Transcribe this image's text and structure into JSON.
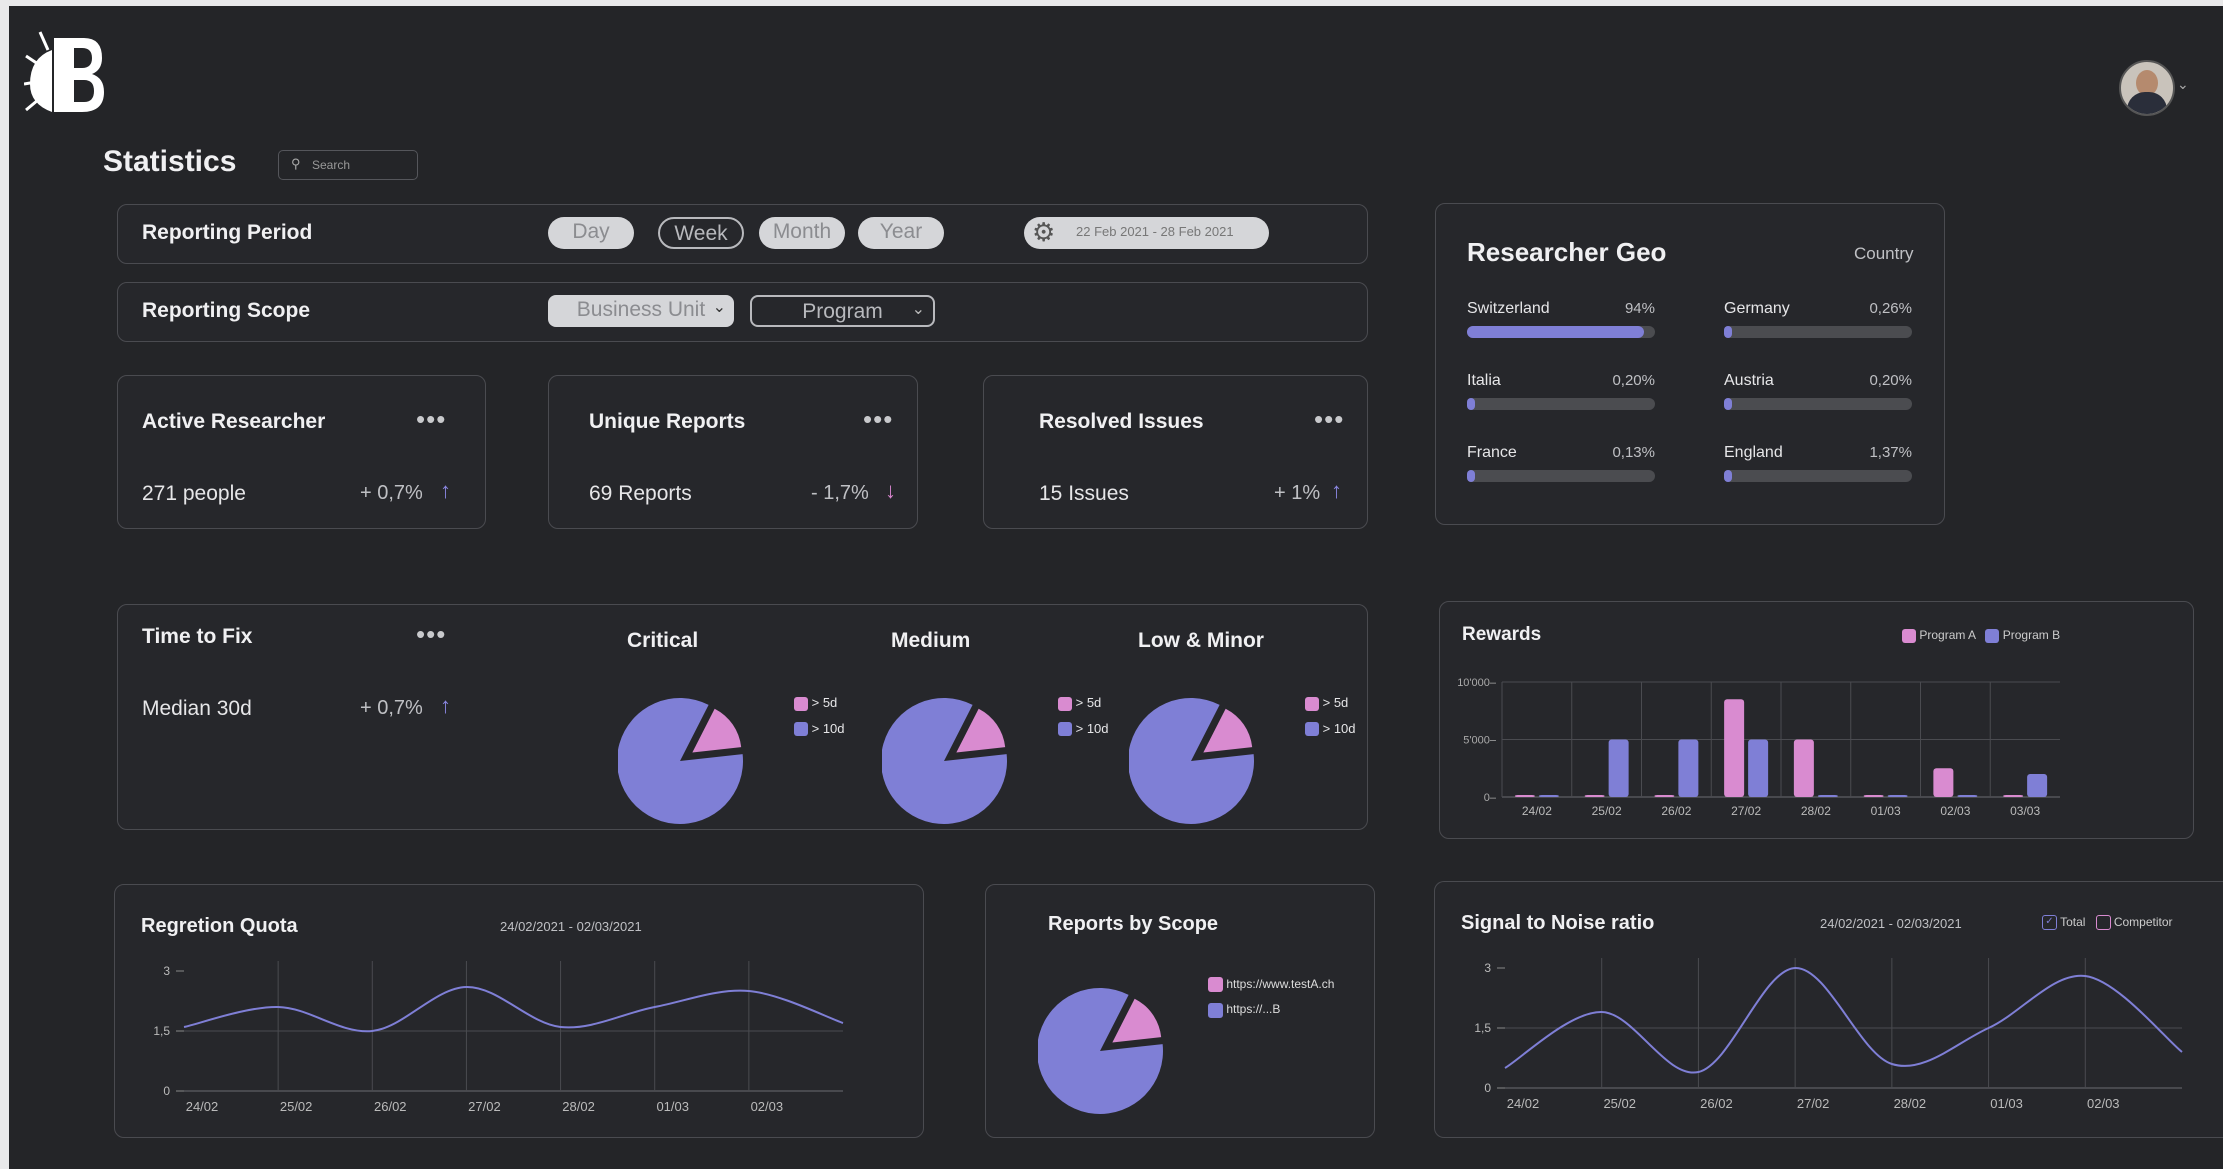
{
  "header": {
    "title": "Statistics",
    "search_placeholder": "Search"
  },
  "reporting_period": {
    "label": "Reporting Period",
    "options": [
      "Day",
      "Week",
      "Month",
      "Year"
    ],
    "date_range": "22 Feb 2021 - 28 Feb 2021"
  },
  "reporting_scope": {
    "label": "Reporting Scope",
    "business_unit": "Business Unit",
    "program": "Program"
  },
  "kpis": [
    {
      "title": "Active Researcher",
      "value": "271 people",
      "change": "+ 0,7%",
      "direction": "up"
    },
    {
      "title": "Unique Reports",
      "value": "69 Reports",
      "change": "- 1,7%",
      "direction": "down"
    },
    {
      "title": "Resolved Issues",
      "value": "15 Issues",
      "change": "+ 1%",
      "direction": "up"
    }
  ],
  "geo": {
    "title": "Researcher Geo",
    "filter": "Country",
    "items": [
      {
        "country": "Switzerland",
        "pct": "94%",
        "value": 0.94
      },
      {
        "country": "Germany",
        "pct": "0,26%",
        "value": 0.0026
      },
      {
        "country": "Italia",
        "pct": "0,20%",
        "value": 0.002
      },
      {
        "country": "Austria",
        "pct": "0,20%",
        "value": 0.002
      },
      {
        "country": "France",
        "pct": "0,13%",
        "value": 0.0013
      },
      {
        "country": "England",
        "pct": "1,37%",
        "value": 0.0137
      }
    ]
  },
  "time_to_fix": {
    "title": "Time to Fix",
    "value": "Median 30d",
    "change": "+ 0,7%",
    "charts": [
      {
        "title": "Critical",
        "legend": [
          "> 5d",
          "> 10d"
        ]
      },
      {
        "title": "Medium",
        "legend": [
          "> 5d",
          "> 10d"
        ]
      },
      {
        "title": "Low & Minor",
        "legend": [
          "> 5d",
          "> 10d"
        ]
      }
    ]
  },
  "rewards": {
    "title": "Rewards",
    "legend": [
      "Program A",
      "Program B"
    ]
  },
  "regression": {
    "title": "Regretion Quota",
    "date_range": "24/02/2021 - 02/03/2021"
  },
  "reports_by_scope": {
    "title": "Reports by Scope",
    "legend": [
      "https://www.testA.ch",
      "https://...B"
    ]
  },
  "signal_noise": {
    "title": "Signal to Noise ratio",
    "date_range": "24/02/2021 - 02/03/2021",
    "legend": [
      "Total",
      "Competitor"
    ]
  },
  "colors": {
    "accent_purple": "#7f7fd6",
    "accent_pink": "#d98bd0",
    "panel_bg": "#26272b",
    "app_bg": "#242528"
  },
  "chart_data": [
    {
      "type": "bar",
      "title": "Rewards",
      "categories": [
        "24/02",
        "25/02",
        "26/02",
        "27/02",
        "28/02",
        "01/03",
        "02/03",
        "03/03"
      ],
      "yticks": [
        "10'000",
        "5'000",
        "0"
      ],
      "ylim": [
        0,
        10000
      ],
      "grid": true,
      "legend": "top-right",
      "series": [
        {
          "name": "Program A",
          "color": "#d98bd0",
          "values": [
            100,
            0,
            0,
            8500,
            5000,
            100,
            2500,
            0
          ]
        },
        {
          "name": "Program B",
          "color": "#7f7fd6",
          "values": [
            100,
            5000,
            5000,
            5000,
            0,
            100,
            0,
            2000
          ]
        }
      ]
    },
    {
      "type": "line",
      "title": "Regretion Quota",
      "x": [
        "24/02",
        "25/02",
        "26/02",
        "27/02",
        "28/02",
        "01/03",
        "02/03"
      ],
      "yticks": [
        "3",
        "1,5",
        "0"
      ],
      "ylim": [
        0,
        3
      ],
      "grid": true,
      "series": [
        {
          "color": "#7f7fd6",
          "values": [
            1.6,
            2.1,
            1.5,
            2.6,
            1.6,
            2.1,
            2.5,
            1.7
          ]
        }
      ]
    },
    {
      "type": "line",
      "title": "Signal to Noise ratio",
      "x": [
        "24/02",
        "25/02",
        "26/02",
        "27/02",
        "28/02",
        "01/03",
        "02/03"
      ],
      "yticks": [
        "3",
        "1,5",
        "0"
      ],
      "ylim": [
        0,
        3
      ],
      "grid": true,
      "legend": "top-right",
      "series": [
        {
          "name": "Total",
          "color": "#7f7fd6",
          "values": [
            0.5,
            1.9,
            0.4,
            3.0,
            0.6,
            1.5,
            2.8,
            0.9
          ]
        }
      ]
    },
    {
      "type": "pie",
      "title": "Critical",
      "labels": [
        "> 5d",
        "> 10d"
      ],
      "values": [
        15,
        85
      ]
    },
    {
      "type": "pie",
      "title": "Medium",
      "labels": [
        "> 5d",
        "> 10d"
      ],
      "values": [
        15,
        85
      ]
    },
    {
      "type": "pie",
      "title": "Low & Minor",
      "labels": [
        "> 5d",
        "> 10d"
      ],
      "values": [
        15,
        85
      ]
    },
    {
      "type": "pie",
      "title": "Reports by Scope",
      "labels": [
        "https://www.testA.ch",
        "https://...B"
      ],
      "values": [
        15,
        85
      ]
    }
  ]
}
